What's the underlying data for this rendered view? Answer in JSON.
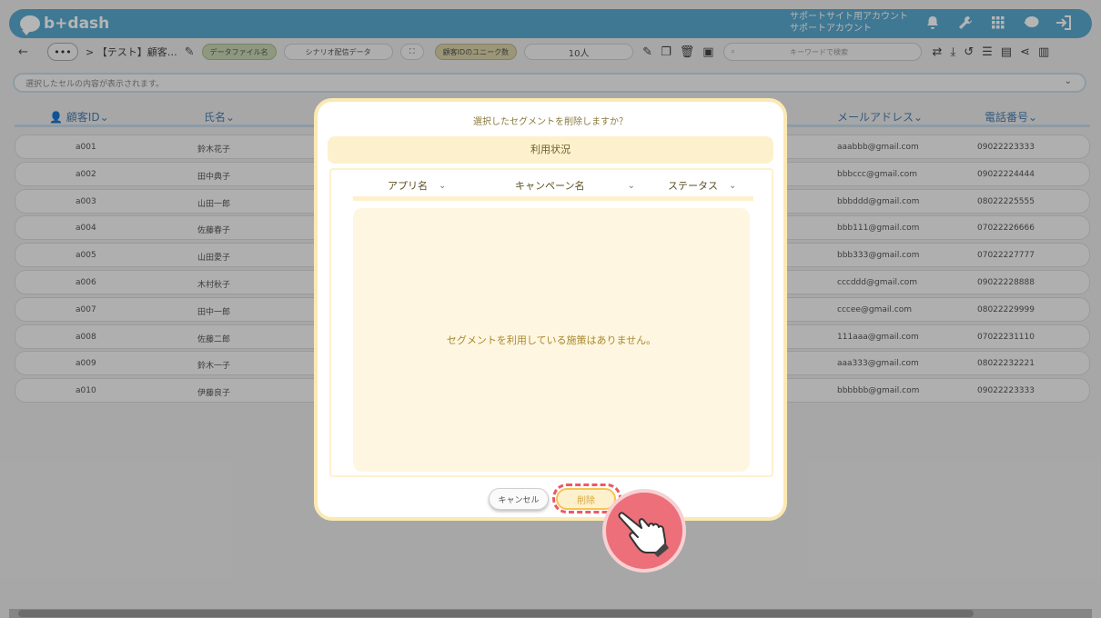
{
  "header": {
    "logo": "b+dash",
    "account_line1": "サポートサイト用アカウント",
    "account_line2": "サポートアカウント",
    "icons": [
      "bell-icon",
      "wrench-icon",
      "grid-icon",
      "chat-icon",
      "logout-icon"
    ]
  },
  "toolbar": {
    "back": "←",
    "more": "•••",
    "breadcrumb": "> 【テスト】顧客…",
    "datafile_tag": "データファイル名",
    "datafile_value": "シナリオ配信データ",
    "unique_tag": "顧客IDのユニーク数",
    "unique_value": "10人",
    "search_placeholder": "キーワードで検索"
  },
  "cellbar": {
    "placeholder": "選択したセルの内容が表示されます。"
  },
  "table": {
    "headers": {
      "id": "顧客ID",
      "name": "氏名",
      "email": "メールアドレス",
      "phone": "電話番号"
    },
    "rows": [
      {
        "id": "a001",
        "name": "鈴木花子",
        "email": "aaabbb@gmail.com",
        "phone": "09022223333"
      },
      {
        "id": "a002",
        "name": "田中典子",
        "email": "bbbccc@gmail.com",
        "phone": "09022224444"
      },
      {
        "id": "a003",
        "name": "山田一郎",
        "email": "bbbddd@gmail.com",
        "phone": "08022225555"
      },
      {
        "id": "a004",
        "name": "佐藤春子",
        "email": "bbb111@gmail.com",
        "phone": "07022226666"
      },
      {
        "id": "a005",
        "name": "山田愛子",
        "email": "bbb333@gmail.com",
        "phone": "07022227777"
      },
      {
        "id": "a006",
        "name": "木村秋子",
        "email": "cccddd@gmail.com",
        "phone": "09022228888"
      },
      {
        "id": "a007",
        "name": "田中一郎",
        "email": "cccee@gmail.com",
        "phone": "08022229999"
      },
      {
        "id": "a008",
        "name": "佐藤二郎",
        "email": "111aaa@gmail.com",
        "phone": "07022231110"
      },
      {
        "id": "a009",
        "name": "鈴木一子",
        "email": "aaa333@gmail.com",
        "phone": "08022232221"
      },
      {
        "id": "a010",
        "name": "伊藤良子",
        "email": "bbbbbb@gmail.com",
        "phone": "09022223333"
      }
    ]
  },
  "dialog": {
    "title": "選択したセグメントを削除しますか？",
    "section_title": "利用状況",
    "col_app": "アプリ名",
    "col_campaign": "キャンペーン名",
    "col_status": "ステータス",
    "empty_message": "セグメントを利用している施策はありません。",
    "cancel_label": "キャンセル",
    "delete_label": "削除"
  },
  "colors": {
    "header_bg": "#5aa9cf",
    "dialog_accent": "#fdf1cd",
    "highlight": "#ea5a66"
  }
}
